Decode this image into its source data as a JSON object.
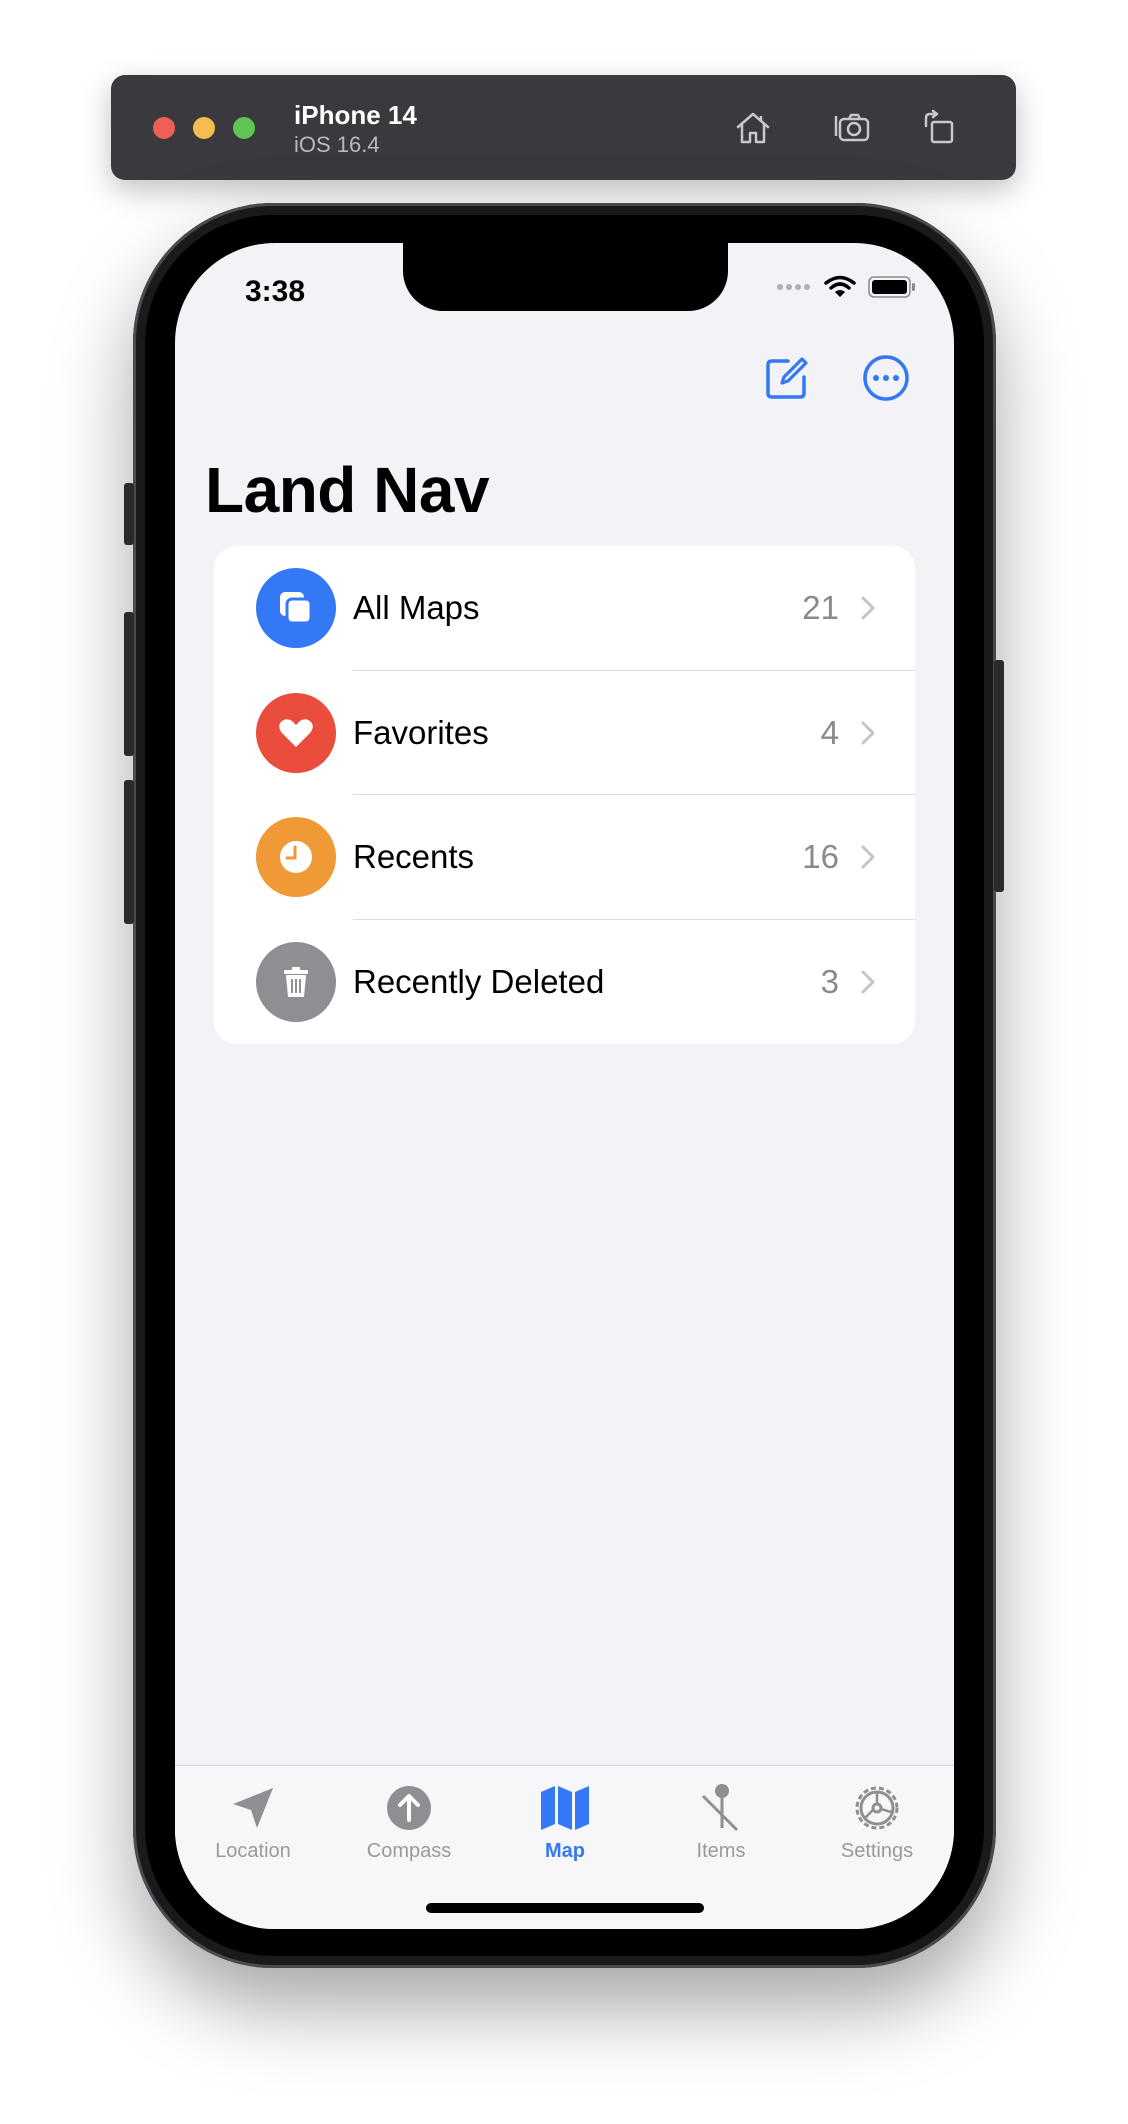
{
  "simulator": {
    "device": "iPhone 14",
    "os": "iOS 16.4",
    "home_icon": "home-icon",
    "screenshot_icon": "camera-icon",
    "rotate_icon": "rotate-icon"
  },
  "status_bar": {
    "time": "3:38"
  },
  "nav": {
    "title": "Land Nav",
    "compose_icon": "compose-icon",
    "more_icon": "ellipsis-circle-icon"
  },
  "list": [
    {
      "label": "All Maps",
      "count": "21",
      "icon": "stack-icon",
      "color": "#3478f6"
    },
    {
      "label": "Favorites",
      "count": "4",
      "icon": "heart-icon",
      "color": "#eb4d3d"
    },
    {
      "label": "Recents",
      "count": "16",
      "icon": "clock-icon",
      "color": "#f09a37"
    },
    {
      "label": "Recently Deleted",
      "count": "3",
      "icon": "trash-icon",
      "color": "#8e8e93"
    }
  ],
  "tabs": [
    {
      "label": "Location",
      "icon": "location-arrow-icon",
      "active": false
    },
    {
      "label": "Compass",
      "icon": "compass-arrow-icon",
      "active": false
    },
    {
      "label": "Map",
      "icon": "map-icon",
      "active": true
    },
    {
      "label": "Items",
      "icon": "pin-icon",
      "active": false
    },
    {
      "label": "Settings",
      "icon": "gear-icon",
      "active": false
    }
  ],
  "colors": {
    "accent": "#3478f6",
    "inactive_tab": "#9a9a9e",
    "background": "#f2f2f7"
  }
}
